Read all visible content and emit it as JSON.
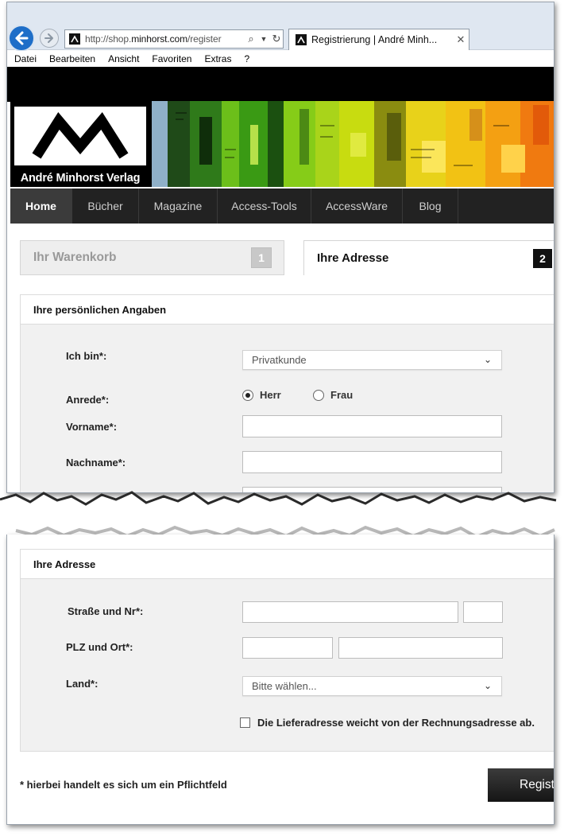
{
  "browser": {
    "url_prefix": "http://shop.",
    "url_domain": "minhorst.com",
    "url_path": "/register",
    "tab_title": "Registrierung | André Minh...",
    "menu": [
      "Datei",
      "Bearbeiten",
      "Ansicht",
      "Favoriten",
      "Extras",
      "?"
    ]
  },
  "site": {
    "logo_text": "André Minhorst Verlag",
    "nav": [
      "Home",
      "Bücher",
      "Magazine",
      "Access-Tools",
      "AccessWare",
      "Blog"
    ],
    "active_nav": "Home"
  },
  "steps": [
    {
      "label": "Ihr Warenkorb",
      "number": "1",
      "active": false
    },
    {
      "label": "Ihre Adresse",
      "number": "2",
      "active": true
    }
  ],
  "personal": {
    "title": "Ihre persönlichen Angaben",
    "customer_type_label": "Ich bin*:",
    "customer_type_value": "Privatkunde",
    "salutation_label": "Anrede*:",
    "salutation_options": [
      "Herr",
      "Frau"
    ],
    "salutation_selected": "Herr",
    "first_name_label": "Vorname*:",
    "last_name_label": "Nachname*:"
  },
  "address": {
    "title": "Ihre Adresse",
    "street_label": "Straße und Nr*:",
    "zip_city_label": "PLZ und Ort*:",
    "country_label": "Land*:",
    "country_placeholder": "Bitte wählen...",
    "different_shipping_label": "Die Lieferadresse weicht von der Rechnungsadresse ab."
  },
  "footer": {
    "required_note": "* hierbei handelt es sich um ein Pflichtfeld",
    "register_button": "Registrieren"
  },
  "colors": {
    "nav_background": "#222222",
    "back_button": "#1e6ec8"
  }
}
